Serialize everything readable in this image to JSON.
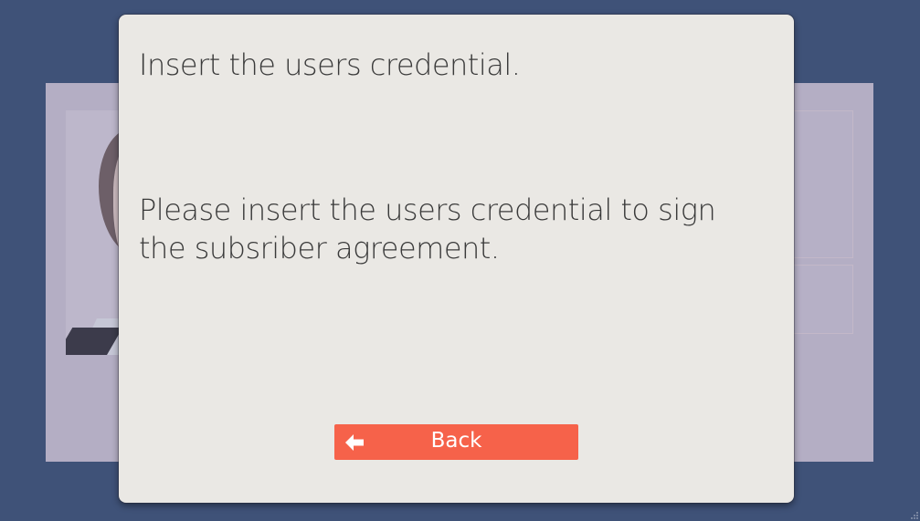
{
  "dialog": {
    "title": "Insert the users credential.",
    "message": "Please insert the users credential to sign the subsriber agreement.",
    "back_button": {
      "label": "Back",
      "icon": "arrow-left-icon",
      "color": "#f6624a"
    }
  },
  "colors": {
    "page_background": "#3f5278",
    "backdrop_card": "#b4aec4",
    "dialog_background": "#eae8e4",
    "text": "#3a3a3a"
  }
}
